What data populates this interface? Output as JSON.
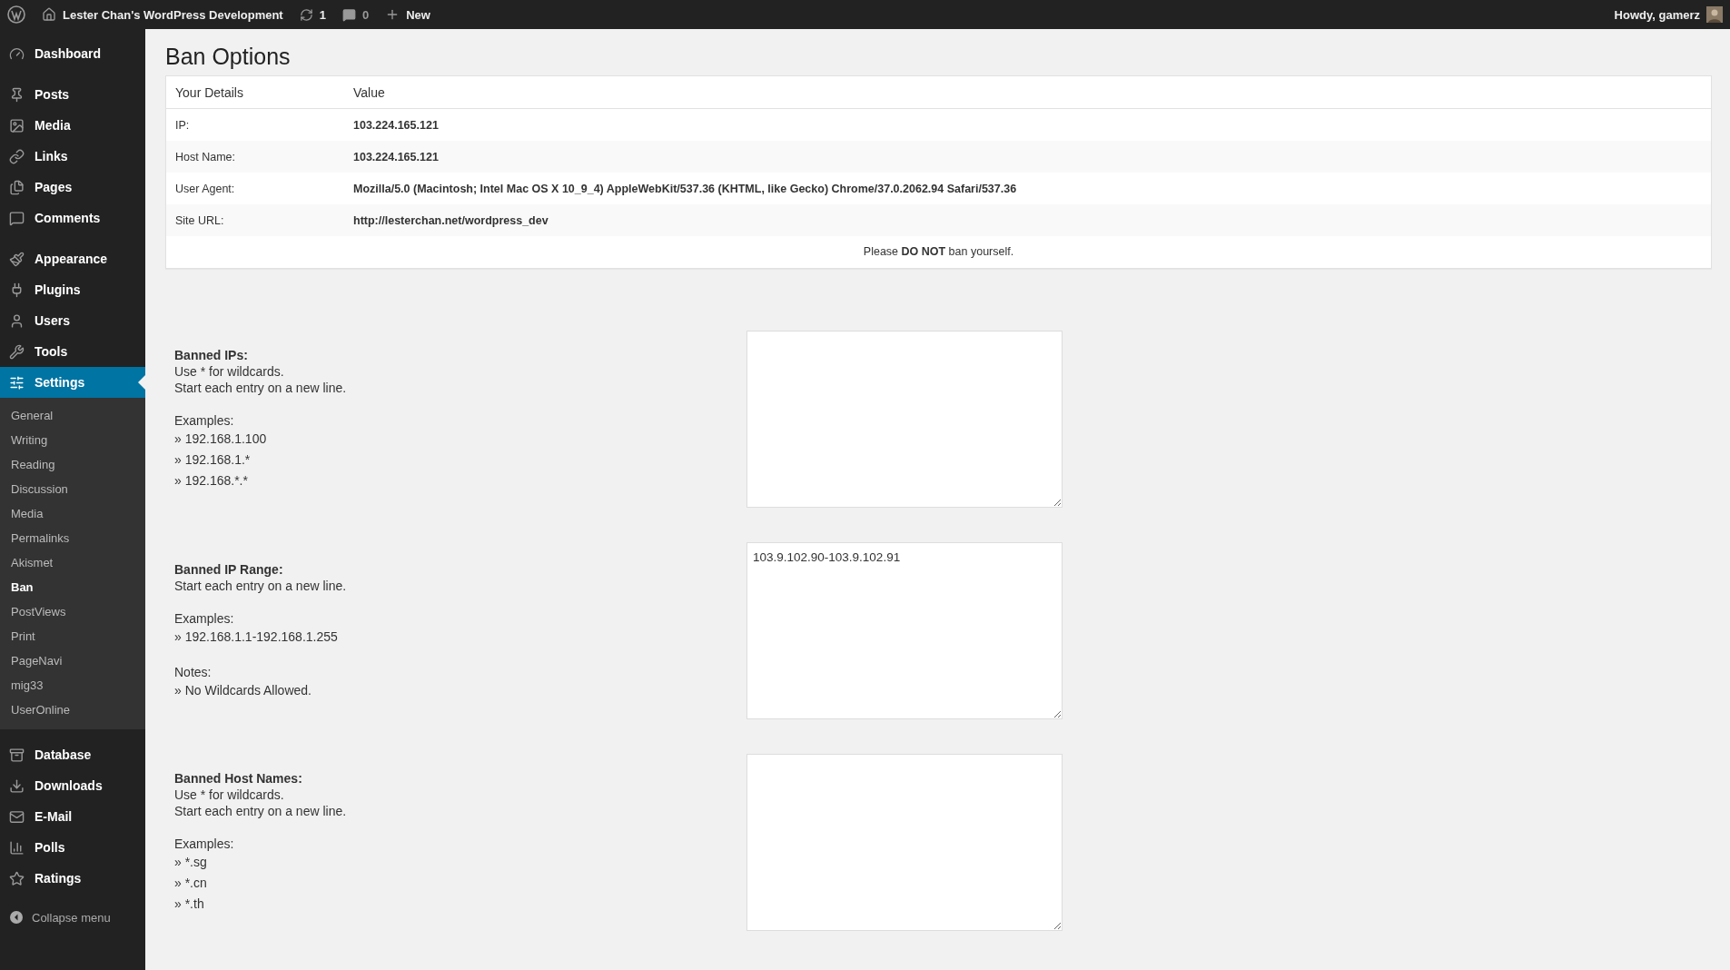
{
  "admin_bar": {
    "site_name": "Lester Chan's WordPress Development",
    "updates": "1",
    "comments": "0",
    "new_label": "New",
    "greeting": "Howdy, gamerz"
  },
  "sidebar": {
    "groups": [
      [
        {
          "label": "Dashboard",
          "selected": false
        }
      ],
      [
        {
          "label": "Posts",
          "selected": false
        },
        {
          "label": "Media",
          "selected": false
        },
        {
          "label": "Links",
          "selected": false
        },
        {
          "label": "Pages",
          "selected": false
        },
        {
          "label": "Comments",
          "selected": false
        }
      ],
      [
        {
          "label": "Appearance",
          "selected": false
        },
        {
          "label": "Plugins",
          "selected": false
        },
        {
          "label": "Users",
          "selected": false
        },
        {
          "label": "Tools",
          "selected": false
        },
        {
          "label": "Settings",
          "selected": true,
          "submenu": [
            {
              "label": "General",
              "selected": false
            },
            {
              "label": "Writing",
              "selected": false
            },
            {
              "label": "Reading",
              "selected": false
            },
            {
              "label": "Discussion",
              "selected": false
            },
            {
              "label": "Media",
              "selected": false
            },
            {
              "label": "Permalinks",
              "selected": false
            },
            {
              "label": "Akismet",
              "selected": false
            },
            {
              "label": "Ban",
              "selected": true
            },
            {
              "label": "PostViews",
              "selected": false
            },
            {
              "label": "Print",
              "selected": false
            },
            {
              "label": "PageNavi",
              "selected": false
            },
            {
              "label": "mig33",
              "selected": false
            },
            {
              "label": "UserOnline",
              "selected": false
            }
          ]
        }
      ],
      [
        {
          "label": "Database",
          "selected": false
        },
        {
          "label": "Downloads",
          "selected": false
        },
        {
          "label": "E-Mail",
          "selected": false
        },
        {
          "label": "Polls",
          "selected": false
        },
        {
          "label": "Ratings",
          "selected": false
        }
      ]
    ],
    "collapse_label": "Collapse menu"
  },
  "page_title": "Ban Options",
  "details_table": {
    "columns": [
      "Your Details",
      "Value"
    ],
    "rows": [
      [
        "IP:",
        "103.224.165.121"
      ],
      [
        "Host Name:",
        "103.224.165.121"
      ],
      [
        "User Agent:",
        "Mozilla/5.0 (Macintosh; Intel Mac OS X 10_9_4) AppleWebKit/537.36 (KHTML, like Gecko) Chrome/37.0.2062.94 Safari/537.36"
      ],
      [
        "Site URL:",
        "http://lesterchan.net/wordpress_dev"
      ]
    ],
    "notice": "Please **DO NOT** ban yourself."
  },
  "fields": [
    {
      "title": "Banned IPs:",
      "lines": [
        "Use * for wildcards.",
        "Start each entry on a new line."
      ],
      "sections": [
        {
          "heading": "Examples:",
          "items": [
            "» 192.168.1.100",
            "» 192.168.1.*",
            "» 192.168.*.*"
          ]
        }
      ]
    },
    {
      "title": "Banned IP Range:",
      "lines": [
        "Start each entry on a new line."
      ],
      "sections": [
        {
          "heading": "Examples:",
          "items": [
            "» 192.168.1.1-192.168.1.255"
          ]
        },
        {
          "heading": "Notes:",
          "items": [
            "» No Wildcards Allowed."
          ]
        }
      ],
      "value": "103.9.102.90-103.9.102.91"
    },
    {
      "title": "Banned Host Names:",
      "lines": [
        "Use * for wildcards.",
        "Start each entry on a new line."
      ],
      "sections": [
        {
          "heading": "Examples:",
          "items": [
            "» *.sg",
            "» *.cn",
            "» *.th"
          ]
        }
      ]
    }
  ]
}
